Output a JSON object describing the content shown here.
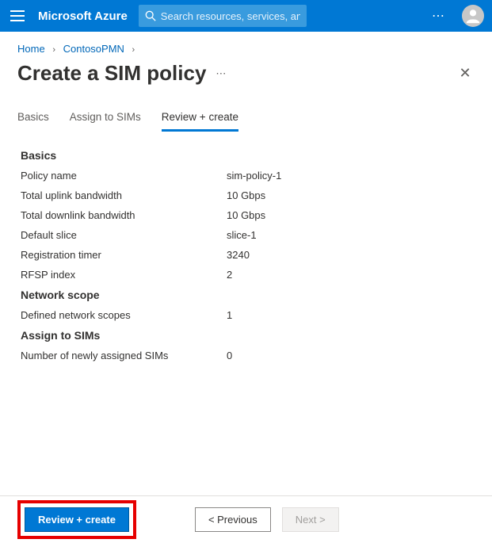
{
  "header": {
    "brand": "Microsoft Azure",
    "search_placeholder": "Search resources, services, and docs (G+/)"
  },
  "breadcrumb": {
    "home": "Home",
    "parent": "ContosoPMN"
  },
  "page": {
    "title": "Create a SIM policy"
  },
  "tabs": {
    "basics": "Basics",
    "assign": "Assign to SIMs",
    "review": "Review + create"
  },
  "sections": {
    "basics": {
      "heading": "Basics",
      "policy_name": {
        "label": "Policy name",
        "value": "sim-policy-1"
      },
      "uplink": {
        "label": "Total uplink bandwidth",
        "value": "10 Gbps"
      },
      "downlink": {
        "label": "Total downlink bandwidth",
        "value": "10 Gbps"
      },
      "default_slice": {
        "label": "Default slice",
        "value": "slice-1"
      },
      "reg_timer": {
        "label": "Registration timer",
        "value": "3240"
      },
      "rfsp": {
        "label": "RFSP index",
        "value": "2"
      }
    },
    "network_scope": {
      "heading": "Network scope",
      "defined": {
        "label": "Defined network scopes",
        "value": "1"
      }
    },
    "assign": {
      "heading": "Assign to SIMs",
      "newly_assigned": {
        "label": "Number of newly assigned SIMs",
        "value": "0"
      }
    }
  },
  "footer": {
    "primary": "Review + create",
    "previous": "<  Previous",
    "next": "Next  >"
  }
}
